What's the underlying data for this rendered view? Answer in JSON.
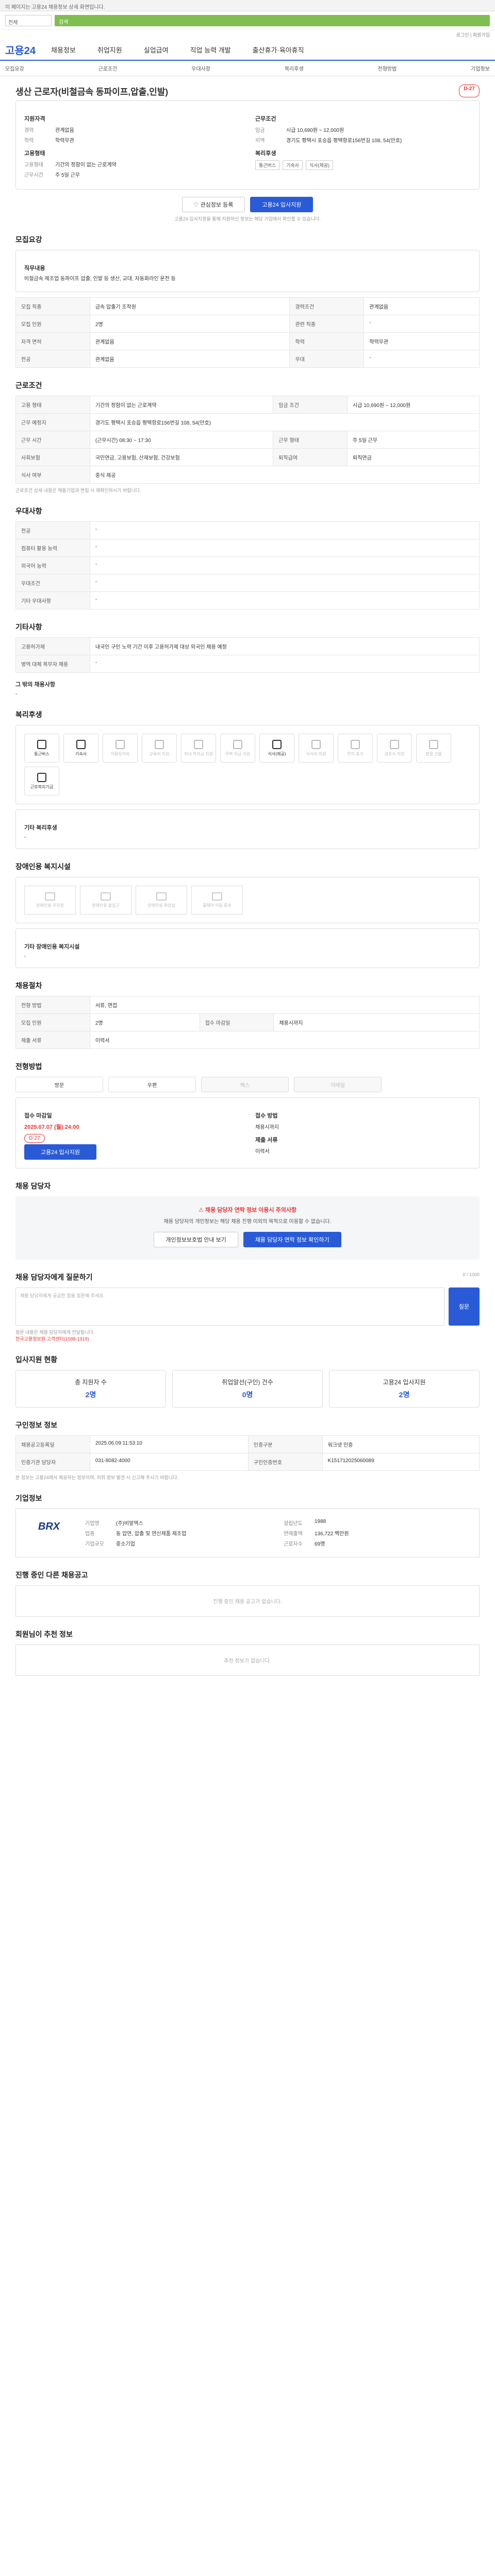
{
  "topbar": {
    "notice": "이 페이지는 고용24 채용정보 상세 화면입니다."
  },
  "search": {
    "label": "검색",
    "select": "전체"
  },
  "header": {
    "tools": "로그인 | 회원가입"
  },
  "gnb": {
    "logo": "고용24",
    "items": [
      "채용정보",
      "취업지원",
      "실업급여",
      "직업 능력 개발",
      "출산휴가·육아휴직"
    ]
  },
  "subnav": {
    "items": [
      "모집요강",
      "근로조건",
      "우대사항",
      "복리후생",
      "전형방법",
      "기업정보"
    ]
  },
  "job": {
    "title": "생산 근로자(비철금속 동파이프,압출,인발)",
    "dday": "D-27",
    "qual_h": "지원자격",
    "experience_k": "경력",
    "experience_v": "관계없음",
    "education_k": "학력",
    "education_v": "학력무관",
    "cond_h": "근무조건",
    "wage_k": "임금",
    "wage_v": "시급 10,690원 ~ 12,000원",
    "region_k": "지역",
    "region_v": "경기도 평택시 포승읍 평택항로156번길 108, 54(만호)",
    "type_h": "고용형태",
    "type_k": "고용형태",
    "type_v": "기간의 정함이 없는 근로계약",
    "hours_k": "근무시간",
    "hours_v": "주 5일 근무",
    "welfare_h": "복리후생",
    "chips": [
      "통근버스",
      "기숙사",
      "식사(제공)"
    ],
    "btn_save": "관심정보 등록",
    "btn_apply": "고용24 입사지원",
    "note": "고용24 입사지원을 통해 지원하신 정보는 해당 기업에서 확인할 수 있습니다."
  },
  "recruit": {
    "title": "모집요강",
    "duty_h": "직무내용",
    "duty_v": "비철금속 제조업 동파이프 압출, 인발 등 생산, 교대, 자동화라인 운전 등",
    "rows": [
      {
        "k": "모집 직종",
        "v": "금속 압출기 조작원",
        "k2": "경력조건",
        "v2": "관계없음"
      },
      {
        "k": "모집 인원",
        "v": "2명",
        "k2": "관련 직종",
        "v2": "-"
      },
      {
        "k": "자격 면허",
        "v": "관계없음",
        "k2": "학력",
        "v2": "학력무관"
      },
      {
        "k": "전공",
        "v": "관계없음",
        "k2": "우대",
        "v2": "-"
      }
    ]
  },
  "cond": {
    "title": "근로조건",
    "rows": [
      {
        "k": "고용 형태",
        "v": "기간의 정함이 없는 근로계약",
        "k2": "임금 조건",
        "v2": "시급 10,690원 ~ 12,000원"
      },
      {
        "k": "근무 예정지",
        "v": "경기도 평택시 포승읍 평택항로156번길 108, 54(만호)",
        "k2": "",
        "v2": ""
      },
      {
        "k": "근무 시간",
        "v": "(근무시간) 08:30 ~ 17:30",
        "k2": "근무 형태",
        "v2": "주 5일 근무"
      },
      {
        "k": "사회보험",
        "v": "국민연금, 고용보험, 산재보험, 건강보험",
        "k2": "퇴직급여",
        "v2": "퇴직연금"
      },
      {
        "k": "식사 여부",
        "v": "중식 제공",
        "k2": "",
        "v2": ""
      }
    ],
    "note": "근로조건 상세 내용은 채용기업과 면접 시 재확인하시기 바랍니다."
  },
  "pref": {
    "title": "우대사항",
    "rows": [
      {
        "k": "전공",
        "v": "-"
      },
      {
        "k": "컴퓨터 활용 능력",
        "v": "-"
      },
      {
        "k": "외국어 능력",
        "v": "-"
      },
      {
        "k": "우대조건",
        "v": "-"
      },
      {
        "k": "기타 우대사항",
        "v": "-"
      }
    ]
  },
  "etc": {
    "title": "기타사항",
    "rows": [
      {
        "k": "고용허가제",
        "v": "내국인 구인 노력 기간 이후 고용허가제 대상 외국인 채용 예정"
      },
      {
        "k": "병역 대체 복무자 채용",
        "v": "-"
      }
    ],
    "other_h": "그 밖의 채용사항",
    "other_v": "-"
  },
  "welfare": {
    "title": "복리후생",
    "items": [
      {
        "label": "통근버스",
        "on": true
      },
      {
        "label": "기숙사",
        "on": true
      },
      {
        "label": "차량유지비",
        "on": false
      },
      {
        "label": "교육비 지원",
        "on": false
      },
      {
        "label": "자녀 학자금 지원",
        "on": false
      },
      {
        "label": "주택 자금 지원",
        "on": false
      },
      {
        "label": "식사(제공)",
        "on": true
      },
      {
        "label": "식사비 지원",
        "on": false
      },
      {
        "label": "연차 휴가",
        "on": false
      },
      {
        "label": "경조사 지원",
        "on": false
      },
      {
        "label": "명절 선물",
        "on": false
      },
      {
        "label": "근로복지기금",
        "on": true
      }
    ],
    "other_h": "기타 복리후생",
    "other_v": "-"
  },
  "disability": {
    "title": "장애인용 복지시설",
    "items": [
      "장애인용 주차장",
      "장애인용 출입구",
      "장애인용 화장실",
      "휠체어 이동 통로"
    ],
    "other_h": "기타 장애인용 복지시설",
    "other_v": "-"
  },
  "hiring": {
    "title": "채용절차",
    "rows": [
      {
        "k": "전형 방법",
        "v": "서류, 면접",
        "k2": "",
        "v2": ""
      },
      {
        "k": "모집 인원",
        "v": "2명",
        "k2": "접수 마감일",
        "v2": "채용시까지"
      },
      {
        "k": "제출 서류",
        "v": "이력서",
        "k2": "",
        "v2": ""
      }
    ]
  },
  "apply": {
    "title": "전형방법",
    "methods": [
      {
        "label": "방문",
        "on": true
      },
      {
        "label": "우편",
        "on": true
      },
      {
        "label": "팩스",
        "on": false
      },
      {
        "label": "이메일",
        "on": false
      }
    ],
    "deadline_h": "접수 마감일",
    "deadline_v": "2025.07.07 (월) 24:00",
    "dday": "D-27",
    "btn": "고용24 입사지원",
    "way_h": "접수 방법",
    "way_v": "채용시까지",
    "docs_h": "제출 서류",
    "docs_v": "이력서"
  },
  "contact": {
    "title": "채용 담당자",
    "warn": "채용 담당자 연락 정보 이용시 주의사항",
    "msg": "채용 담당자의 개인정보는 해당 채용 진행 이외의 목적으로 이용할 수 없습니다.",
    "btn1": "개인정보보호법 안내 보기",
    "btn2": "채용 담당자 연락 정보 확인하기"
  },
  "qa": {
    "title": "채용 담당자에게 질문하기",
    "count": "0 / 1000",
    "placeholder": "채용 담당자에게 궁금한 점을 질문해 주세요.",
    "btn": "질문",
    "note1": "질문 내용은 채용 담당자에게 전달됩니다.",
    "note2": "한국고용정보원 고객센터(1588-1919)"
  },
  "status": {
    "title": "입사지원 현황",
    "items": [
      {
        "label": "총 지원자 수",
        "n": "2명"
      },
      {
        "label": "취업알선(구인) 건수",
        "n": "0명"
      },
      {
        "label": "고용24 입사지원",
        "n": "2명"
      }
    ]
  },
  "meta": {
    "title": "구인정보 정보",
    "rows": [
      {
        "k": "채용공고등록일",
        "v": "2025.06.09 11:53:10",
        "k2": "인증구분",
        "v2": "워크넷 인증"
      },
      {
        "k": "인증기관 담당자",
        "v": "031-8082-4000",
        "k2": "구인인증번호",
        "v2": "K151712025060089"
      }
    ],
    "note": "본 정보는 고용24에서 제공하는 정보이며, 허위 정보 발견 시 신고해 주시기 바랍니다."
  },
  "company": {
    "title": "기업정보",
    "logo": "BRX",
    "name_k": "기업명",
    "name_v": "(주)비알엑스",
    "industry_k": "업종",
    "industry_v": "동 압연, 압출 및 연신제품 제조업",
    "scale_k": "기업규모",
    "scale_v": "중소기업",
    "founded_k": "설립년도",
    "founded_v": "1988",
    "sales_k": "연매출액",
    "sales_v": "136,722 백만원",
    "staff_k": "근로자수",
    "staff_v": "69명"
  },
  "others": {
    "title": "진행 중인 다른 채용공고",
    "empty": "진행 중인 채용 공고가 없습니다."
  },
  "recommend": {
    "title": "회원님이 추천 정보",
    "empty": "추천 정보가 없습니다."
  }
}
